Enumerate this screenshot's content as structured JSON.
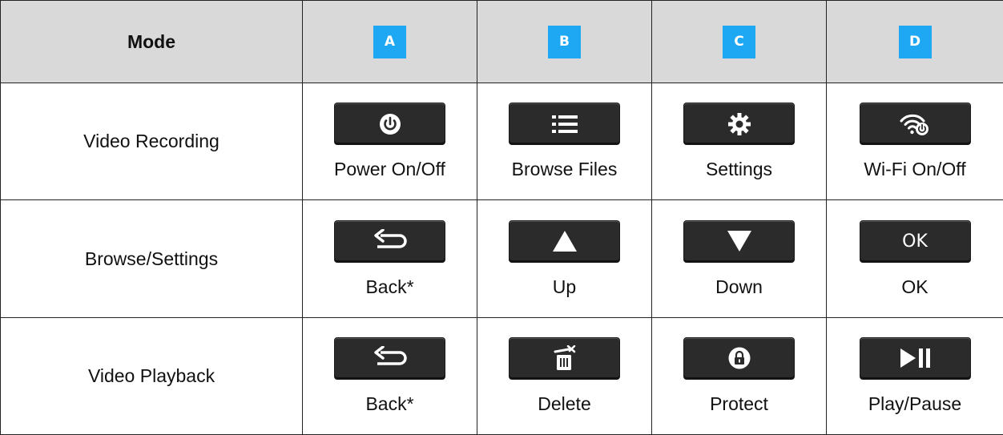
{
  "header": {
    "mode_label": "Mode",
    "columns": [
      "A",
      "B",
      "C",
      "D"
    ],
    "header_bg": "#d9d9d9",
    "badge_color": "#1ea7f2"
  },
  "rows": [
    {
      "mode": "Video Recording",
      "buttons": [
        {
          "icon": "power-icon",
          "label": "Power On/Off"
        },
        {
          "icon": "list-icon",
          "label": "Browse Files"
        },
        {
          "icon": "gear-icon",
          "label": "Settings"
        },
        {
          "icon": "wifi-power-icon",
          "label": "Wi-Fi On/Off"
        }
      ]
    },
    {
      "mode": "Browse/Settings",
      "buttons": [
        {
          "icon": "back-arrow-icon",
          "label": "Back*"
        },
        {
          "icon": "up-triangle-icon",
          "label": "Up"
        },
        {
          "icon": "down-triangle-icon",
          "label": "Down"
        },
        {
          "icon": "ok-icon",
          "icon_text": "OK",
          "label": "OK"
        }
      ]
    },
    {
      "mode": "Video Playback",
      "buttons": [
        {
          "icon": "back-arrow-icon",
          "label": "Back*"
        },
        {
          "icon": "trash-icon",
          "label": "Delete"
        },
        {
          "icon": "lock-icon",
          "label": "Protect"
        },
        {
          "icon": "play-pause-icon",
          "label": "Play/Pause"
        }
      ]
    }
  ],
  "button_color": "#2b2b2b"
}
